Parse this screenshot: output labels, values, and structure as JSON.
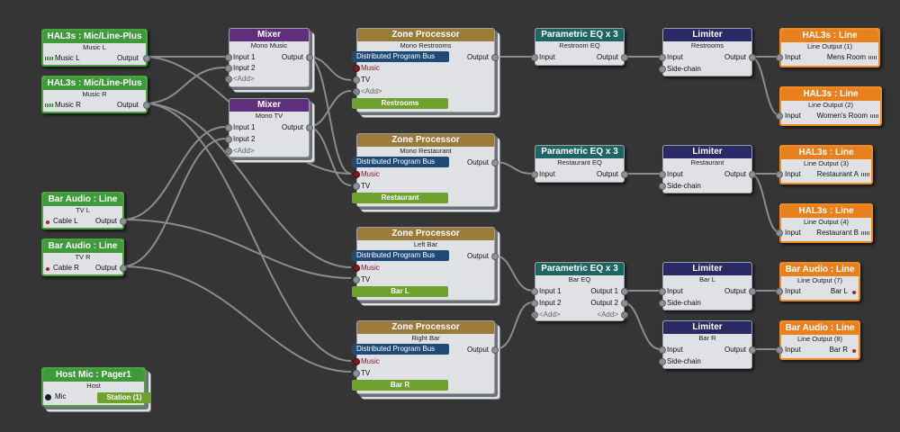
{
  "colors": {
    "bg": "#353535",
    "wire": "#8c8c8c"
  },
  "hal_mic_l": {
    "title": "HAL3s : Mic/Line-Plus",
    "sub": "Music L",
    "in": "Music L",
    "out": "Output"
  },
  "hal_mic_r": {
    "title": "HAL3s : Mic/Line-Plus",
    "sub": "Music R",
    "in": "Music R",
    "out": "Output"
  },
  "bar_tv_l": {
    "title": "Bar Audio : Line",
    "sub": "TV L",
    "in": "Cable L",
    "out": "Output"
  },
  "bar_tv_r": {
    "title": "Bar Audio : Line",
    "sub": "TV R",
    "in": "Cable R",
    "out": "Output"
  },
  "host_mic": {
    "title": "Host Mic : Pager1",
    "sub": "Host",
    "in": "Mic",
    "station": "Station (1)"
  },
  "mixer_music": {
    "title": "Mixer",
    "sub": "Mono Music",
    "in1": "Input 1",
    "in2": "Input 2",
    "add": "<Add>",
    "out": "Output"
  },
  "mixer_tv": {
    "title": "Mixer",
    "sub": "Mono TV",
    "in1": "Input 1",
    "in2": "Input 2",
    "add": "<Add>",
    "out": "Output"
  },
  "zp_restrooms": {
    "title": "Zone Processor",
    "sub": "Mono Restrooms",
    "dpb": "Distributed Program Bus",
    "music": "Music",
    "tv": "TV",
    "add": "<Add>",
    "out": "Output",
    "zone": "Restrooms"
  },
  "zp_restaurant": {
    "title": "Zone Processor",
    "sub": "Mono Restaurant",
    "dpb": "Distributed Program Bus",
    "music": "Music",
    "tv": "TV",
    "out": "Output",
    "zone": "Restaurant"
  },
  "zp_leftbar": {
    "title": "Zone Processor",
    "sub": "Left Bar",
    "dpb": "Distributed Program Bus",
    "music": "Music",
    "tv": "TV",
    "out": "Output",
    "zone": "Bar L"
  },
  "zp_rightbar": {
    "title": "Zone Processor",
    "sub": "Right Bar",
    "dpb": "Distributed Program Bus",
    "music": "Music",
    "tv": "TV",
    "out": "Output",
    "zone": "Bar R"
  },
  "eq_restroom": {
    "title": "Parametric EQ x 3",
    "sub": "Restroom EQ",
    "in": "Input",
    "out": "Output"
  },
  "eq_restaurant": {
    "title": "Parametric EQ x 3",
    "sub": "Restaurant EQ",
    "in": "Input",
    "out": "Output"
  },
  "eq_bar": {
    "title": "Parametric EQ x 3",
    "sub": "Bar EQ",
    "in1": "Input 1",
    "in2": "Input 2",
    "add_in": "<Add>",
    "out1": "Output 1",
    "out2": "Output 2",
    "add_out": "<Add>"
  },
  "lim_restrooms": {
    "title": "Limiter",
    "sub": "Restrooms",
    "in": "Input",
    "side": "Side-chain",
    "out": "Output"
  },
  "lim_restaurant": {
    "title": "Limiter",
    "sub": "Restaurant",
    "in": "Input",
    "side": "Side-chain",
    "out": "Output"
  },
  "lim_barl": {
    "title": "Limiter",
    "sub": "Bar L",
    "in": "Input",
    "side": "Side-chain",
    "out": "Output"
  },
  "lim_barr": {
    "title": "Limiter",
    "sub": "Bar R",
    "in": "Input",
    "side": "Side-chain",
    "out": "Output"
  },
  "out1": {
    "title": "HAL3s : Line",
    "sub": "Line Output (1)",
    "in": "Input",
    "dest": "Mens Room"
  },
  "out2": {
    "title": "HAL3s : Line",
    "sub": "Line Output (2)",
    "in": "Input",
    "dest": "Women's Room"
  },
  "out3": {
    "title": "HAL3s : Line",
    "sub": "Line Output (3)",
    "in": "Input",
    "dest": "Restaurant A"
  },
  "out4": {
    "title": "HAL3s : Line",
    "sub": "Line Output (4)",
    "in": "Input",
    "dest": "Restaurant B"
  },
  "out7": {
    "title": "Bar Audio : Line",
    "sub": "Line Output (7)",
    "in": "Input",
    "dest": "Bar L"
  },
  "out8": {
    "title": "Bar Audio : Line",
    "sub": "Line Output (8)",
    "in": "Input",
    "dest": "Bar R"
  }
}
